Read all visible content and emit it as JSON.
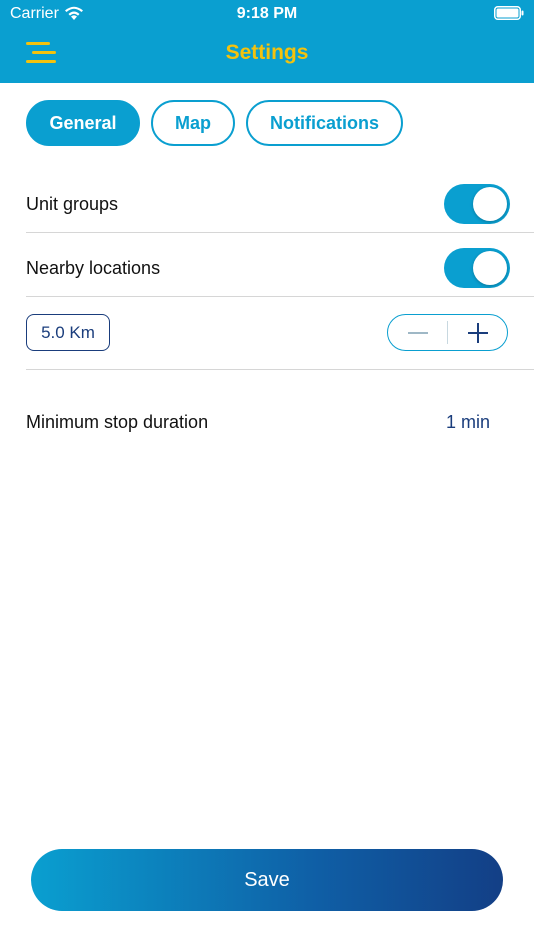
{
  "status_bar": {
    "carrier": "Carrier",
    "time": "9:18 PM"
  },
  "header": {
    "title": "Settings",
    "menu_icon": "hamburger-menu-icon",
    "background_color": "#0a9fd0",
    "title_color": "#f4c20d"
  },
  "tabs": [
    {
      "label": "General",
      "active": true
    },
    {
      "label": "Map",
      "active": false
    },
    {
      "label": "Notifications",
      "active": false
    }
  ],
  "settings": {
    "unit_groups": {
      "label": "Unit groups",
      "enabled": true
    },
    "nearby_locations": {
      "label": "Nearby locations",
      "enabled": true
    },
    "distance": {
      "value": "5.0 Km"
    },
    "minimum_stop_duration": {
      "label": "Minimum stop duration",
      "value": "1 min"
    }
  },
  "save_button": {
    "label": "Save"
  }
}
